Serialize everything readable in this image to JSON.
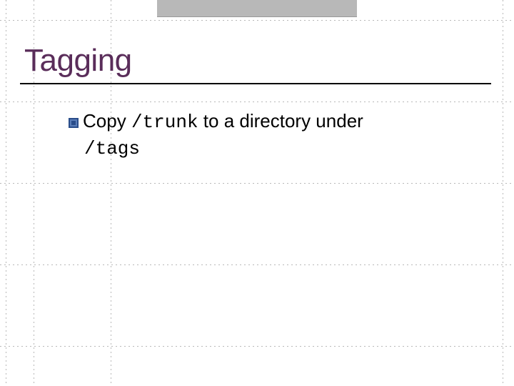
{
  "slide": {
    "title": "Tagging",
    "body": {
      "text_before_code1": "Copy",
      "code1": "/trunk",
      "text_mid": "to a directory under",
      "code2": "/tags"
    }
  }
}
